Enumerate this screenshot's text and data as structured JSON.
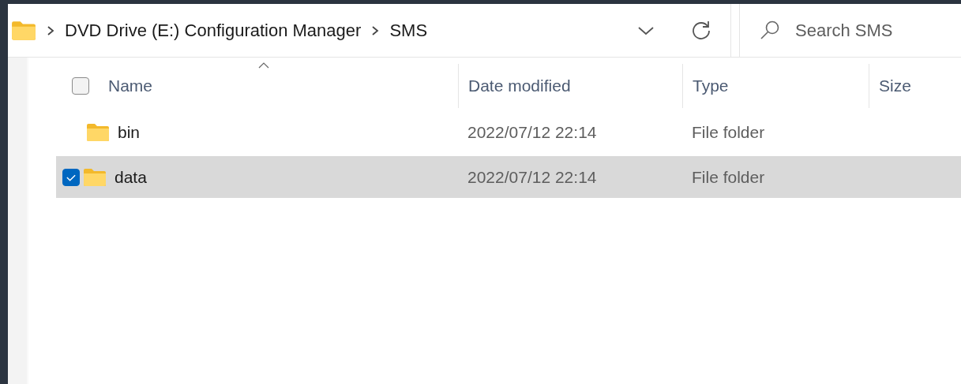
{
  "address_bar": {
    "breadcrumbs": [
      {
        "label": "DVD Drive (E:) Configuration Manager"
      },
      {
        "label": "SMS"
      }
    ]
  },
  "search": {
    "placeholder": "Search SMS"
  },
  "table": {
    "select_all": {
      "checked": false
    },
    "columns": [
      {
        "label": "Name",
        "sorted": true
      },
      {
        "label": "Date modified",
        "sorted": false
      },
      {
        "label": "Type",
        "sorted": false
      },
      {
        "label": "Size",
        "sorted": false
      }
    ],
    "rows": [
      {
        "name": "bin",
        "date_modified": "2022/07/12 22:14",
        "type": "File folder",
        "selected": false,
        "checked": false
      },
      {
        "name": "data",
        "date_modified": "2022/07/12 22:14",
        "type": "File folder",
        "selected": true,
        "checked": true
      }
    ]
  }
}
